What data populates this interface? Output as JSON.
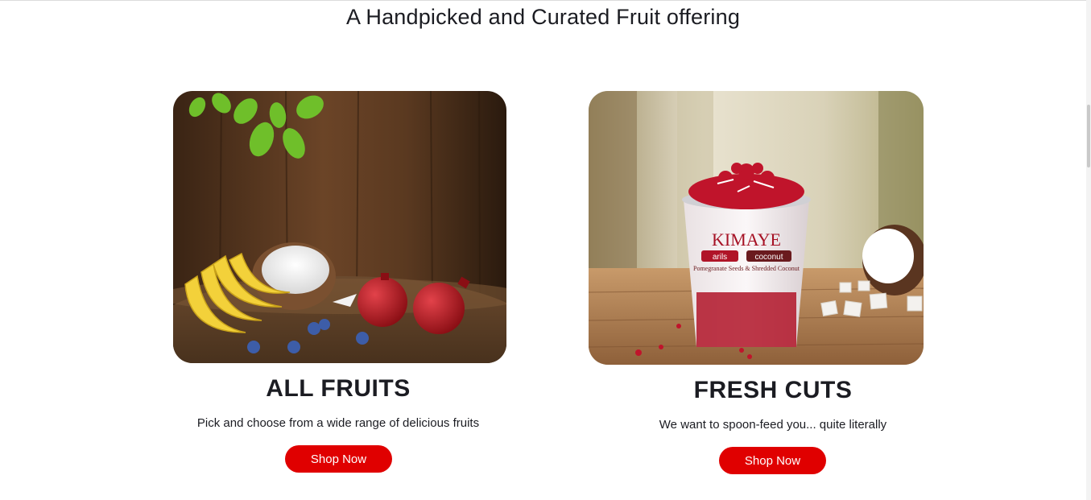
{
  "section": {
    "title": "A Handpicked and Curated Fruit offering"
  },
  "cards": [
    {
      "title": "ALL FRUITS",
      "description": "Pick and choose from a wide range of delicious fruits",
      "button_label": "Shop Now",
      "image_alt": "Bananas, coconut, pomegranates and blueberries on a wooden table"
    },
    {
      "title": "FRESH CUTS",
      "description": "We want to spoon-feed you... quite literally",
      "button_label": "Shop Now",
      "image_alt": "KIMAYE cup of pomegranate arils with shredded coconut",
      "cup_brand": "KIMAYE",
      "cup_label_left": "arils",
      "cup_label_right": "coconut",
      "cup_subtext": "Pomegranate Seeds & Shredded Coconut"
    }
  ],
  "colors": {
    "accent": "#e00000",
    "heading": "#1b1c22",
    "background": "#ffffff"
  }
}
